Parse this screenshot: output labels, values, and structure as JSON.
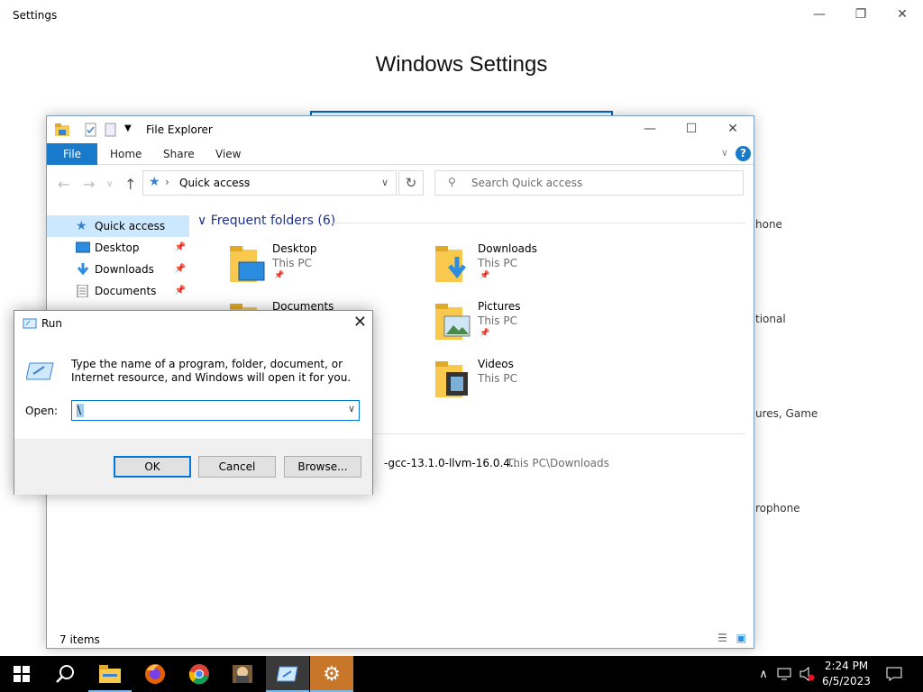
{
  "settings": {
    "window_title": "Settings",
    "heading": "Windows Settings",
    "fragments": [
      "hone",
      "tional",
      "ures, Game",
      "rophone"
    ]
  },
  "explorer": {
    "title": "File Explorer",
    "ribbon_tabs": [
      "File",
      "Home",
      "Share",
      "View"
    ],
    "address": "Quick access",
    "search_placeholder": "Search Quick access",
    "sidebar": [
      {
        "label": "Quick access",
        "icon": "star-icon"
      },
      {
        "label": "Desktop",
        "icon": "desktop-icon"
      },
      {
        "label": "Downloads",
        "icon": "download-icon"
      },
      {
        "label": "Documents",
        "icon": "document-icon"
      }
    ],
    "group_heading": "Frequent folders (6)",
    "folders": [
      {
        "name": "Desktop",
        "location": "This PC"
      },
      {
        "name": "Downloads",
        "location": "This PC"
      },
      {
        "name": "Documents",
        "location": ""
      },
      {
        "name": "Pictures",
        "location": "This PC"
      },
      {
        "name": "Videos",
        "location": "This PC"
      }
    ],
    "recent_file": "-gcc-13.1.0-llvm-16.0.4...",
    "recent_path": "This PC\\Downloads",
    "status": "7 items"
  },
  "run": {
    "title": "Run",
    "description": "Type the name of a program, folder, document, or Internet resource, and Windows will open it for you.",
    "open_label": "Open:",
    "open_value": "\\",
    "ok": "OK",
    "cancel": "Cancel",
    "browse": "Browse..."
  },
  "taskbar": {
    "time": "2:24 PM",
    "date": "6/5/2023"
  },
  "colors": {
    "accent": "#0078d7",
    "folder": "#f8c94d",
    "selection": "#cce8ff"
  }
}
